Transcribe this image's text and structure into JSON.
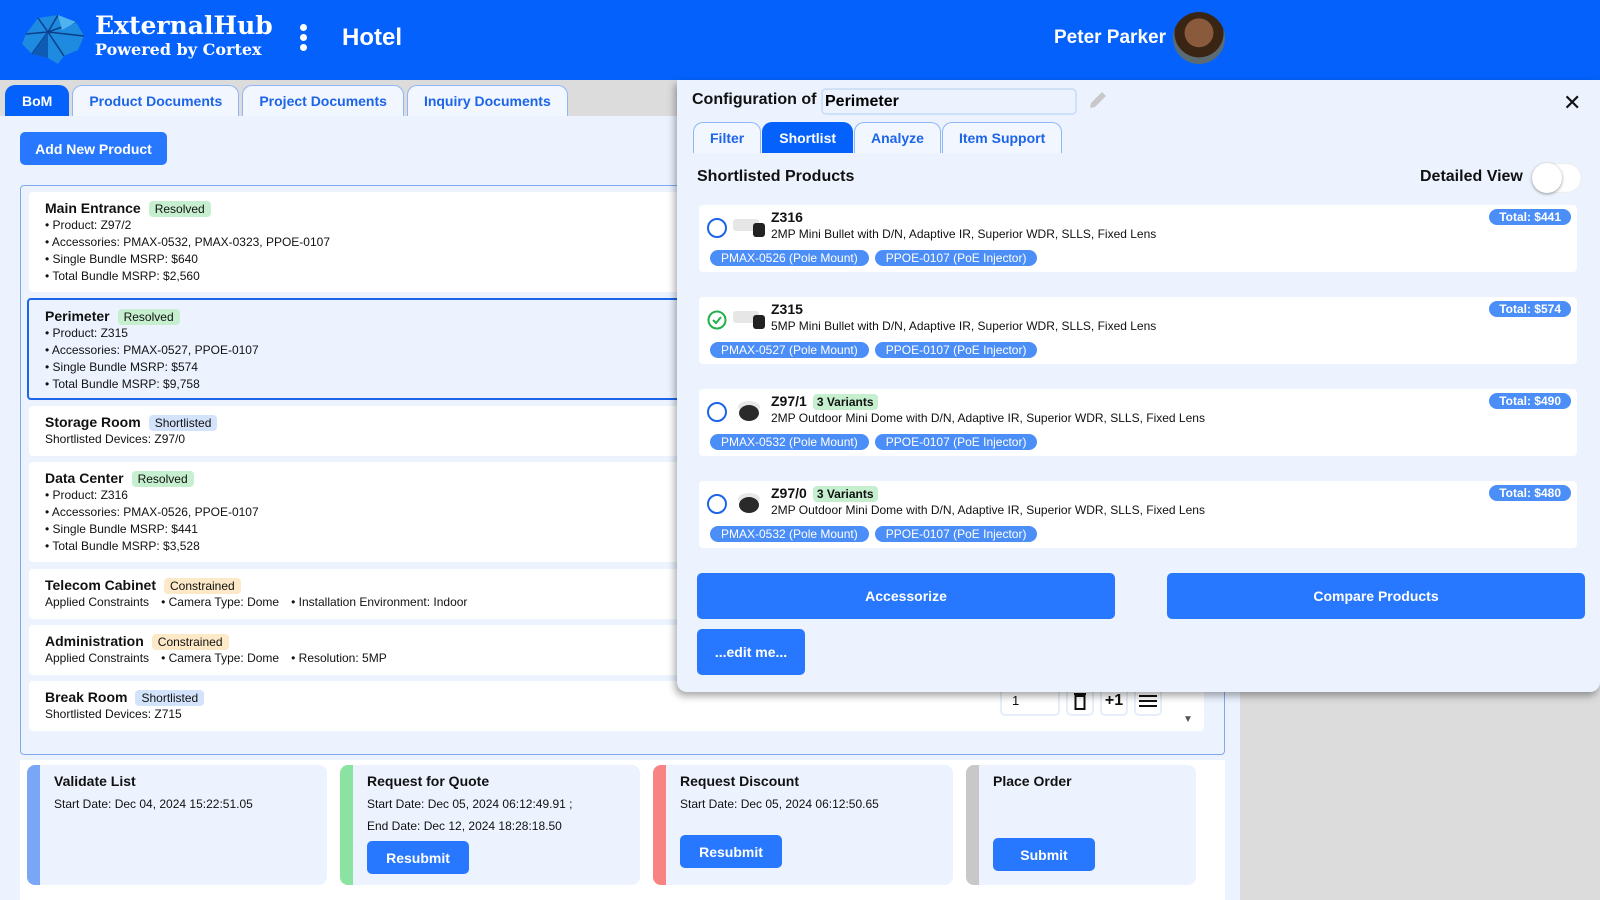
{
  "header": {
    "brand_title": "ExternalHub",
    "brand_subtitle": "Powered by Cortex",
    "project": "Hotel",
    "user_name": "Peter Parker",
    "accent_color": "#0461fb"
  },
  "tabs": [
    {
      "label": "BoM",
      "active": true
    },
    {
      "label": "Product Documents"
    },
    {
      "label": "Project Documents"
    },
    {
      "label": "Inquiry Documents"
    }
  ],
  "add_product_label": "Add New Product",
  "locations": [
    {
      "name": "Main Entrance",
      "status": "Resolved",
      "lines": [
        "Product: Z97/2",
        "Accessories: PMAX-0532, PMAX-0323, PPOE-0107",
        "Single Bundle MSRP: $640",
        "Total Bundle MSRP: $2,560"
      ]
    },
    {
      "name": "Perimeter",
      "status": "Resolved",
      "lines": [
        "Product: Z315",
        "Accessories: PMAX-0527, PPOE-0107",
        "Single Bundle MSRP: $574",
        "Total Bundle MSRP: $9,758"
      ]
    },
    {
      "name": "Storage Room",
      "status": "Shortlisted",
      "text": "Shortlisted Devices: Z97/0"
    },
    {
      "name": "Data Center",
      "status": "Resolved",
      "lines": [
        "Product: Z316",
        "Accessories: PMAX-0526, PPOE-0107",
        "Single Bundle MSRP: $441",
        "Total Bundle MSRP: $3,528"
      ]
    },
    {
      "name": "Telecom Cabinet",
      "status": "Constrained",
      "constraints_label": "Applied Constraints",
      "constraints": [
        "Camera Type: Dome",
        "Installation Environment: Indoor"
      ]
    },
    {
      "name": "Administration",
      "status": "Constrained",
      "constraints_label": "Applied Constraints",
      "constraints": [
        "Camera Type: Dome",
        "Resolution: 5MP"
      ]
    },
    {
      "name": "Break Room",
      "status": "Shortlisted",
      "text": "Shortlisted Devices: Z715",
      "quantity": "1",
      "plus_one_label": "+1"
    }
  ],
  "steps": [
    {
      "title": "Validate List",
      "start": "Start Date: Dec 04, 2024 15:22:51.05",
      "color": "#7aa7f5"
    },
    {
      "title": "Request for Quote",
      "start": "Start Date: Dec 05, 2024 06:12:49.91  ;",
      "end": "End Date: Dec 12, 2024 18:28:18.50",
      "button": "Resubmit",
      "color": "#8be3a2"
    },
    {
      "title": "Request Discount",
      "start": "Start Date: Dec 05, 2024 06:12:50.65",
      "button": "Resubmit",
      "color": "#f98282"
    },
    {
      "title": "Place Order",
      "button": "Submit",
      "color": "#c8c8c8"
    }
  ],
  "config": {
    "label": "Configuration of",
    "name_value": "Perimeter",
    "tabs": [
      {
        "label": "Filter"
      },
      {
        "label": "Shortlist",
        "active": true
      },
      {
        "label": "Analyze"
      },
      {
        "label": "Item Support"
      }
    ],
    "section_title": "Shortlisted Products",
    "detailed_view_label": "Detailed View",
    "detailed_view_on": false,
    "products": [
      {
        "model": "Z316",
        "desc": "2MP Mini Bullet with D/N, Adaptive IR, Superior WDR, SLLS, Fixed Lens",
        "chips": [
          "PMAX-0526 (Pole Mount)",
          "PPOE-0107 (PoE Injector)"
        ],
        "total": "Total: $441",
        "selected": false,
        "icon": "bullet-camera-icon"
      },
      {
        "model": "Z315",
        "desc": "5MP Mini Bullet with D/N, Adaptive IR, Superior WDR, SLLS, Fixed Lens",
        "chips": [
          "PMAX-0527 (Pole Mount)",
          "PPOE-0107 (PoE Injector)"
        ],
        "total": "Total: $574",
        "selected": true,
        "icon": "bullet-camera-icon"
      },
      {
        "model": "Z97/1",
        "variants": "3 Variants",
        "desc": "2MP Outdoor Mini Dome with D/N, Adaptive IR, Superior WDR, SLLS, Fixed Lens",
        "chips": [
          "PMAX-0532 (Pole Mount)",
          "PPOE-0107 (PoE Injector)"
        ],
        "total": "Total: $490",
        "selected": false,
        "icon": "dome-camera-icon"
      },
      {
        "model": "Z97/0",
        "variants": "3 Variants",
        "desc": "2MP Outdoor Mini Dome with D/N, Adaptive IR, Superior WDR, SLLS, Fixed Lens",
        "chips": [
          "PMAX-0532 (Pole Mount)",
          "PPOE-0107 (PoE Injector)"
        ],
        "total": "Total: $480",
        "selected": false,
        "icon": "dome-camera-icon"
      }
    ],
    "accessorize_label": "Accessorize",
    "compare_label": "Compare Products",
    "edit_label": "...edit me..."
  }
}
